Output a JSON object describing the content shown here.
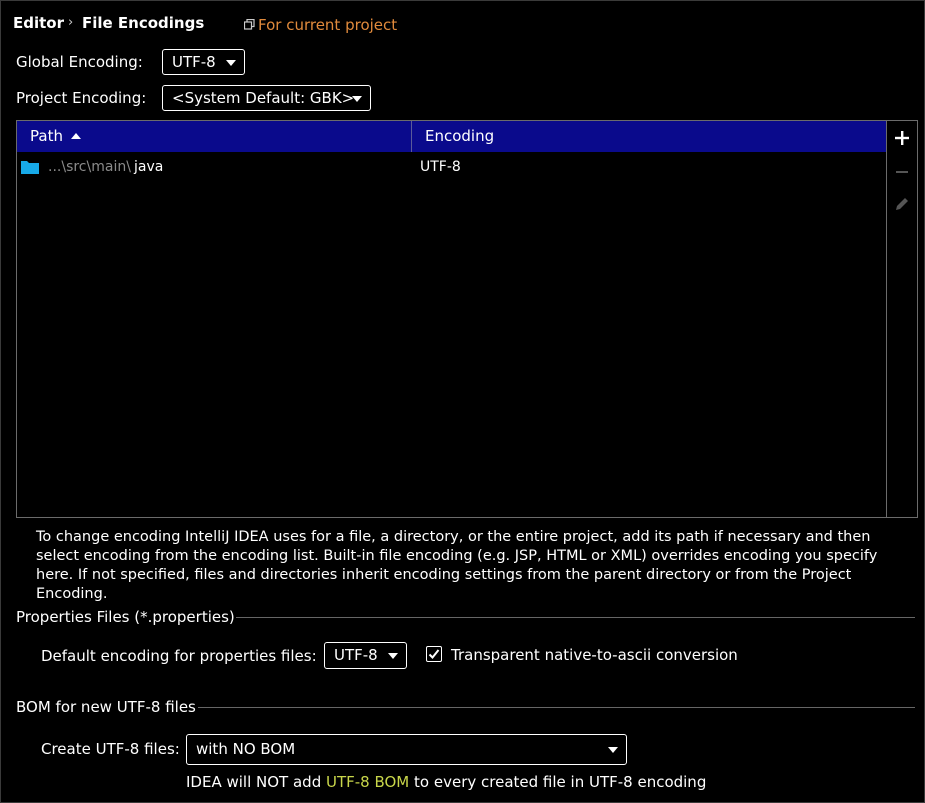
{
  "breadcrumb": {
    "parent": "Editor",
    "separator": "›",
    "current": "File Encodings"
  },
  "scope_link": {
    "icon": "copy-icon",
    "label": "For current project"
  },
  "global_encoding": {
    "label": "Global Encoding:",
    "value": "UTF-8"
  },
  "project_encoding": {
    "label": "Project Encoding:",
    "value": "<System Default: GBK>"
  },
  "table": {
    "columns": [
      "Path",
      "Encoding"
    ],
    "sort": {
      "column": "Path",
      "direction": "ascending"
    },
    "rows": [
      {
        "icon": "folder-icon",
        "path_prefix": "...\\src\\main\\",
        "path_name": "java",
        "encoding": "UTF-8"
      }
    ]
  },
  "toolbar": {
    "add_icon": "plus-icon",
    "remove_icon": "minus-icon",
    "edit_icon": "pencil-icon"
  },
  "help_text": "To change encoding IntelliJ IDEA uses for a file, a directory, or the entire project, add its path if necessary and then select encoding from the encoding list. Built-in file encoding (e.g. JSP, HTML or XML) overrides encoding you specify here. If not specified, files and directories inherit encoding settings from the parent directory or from the Project Encoding.",
  "properties_section": {
    "title": "Properties Files (*.properties)",
    "default_label": "Default encoding for properties files:",
    "default_value": "UTF-8",
    "native_to_ascii": {
      "label": "Transparent native-to-ascii conversion",
      "checked": true
    }
  },
  "bom_section": {
    "title": "BOM for new UTF-8 files",
    "create_label": "Create UTF-8 files:",
    "create_value": "with NO BOM",
    "note_before": "IDEA will NOT add ",
    "note_highlight": "UTF-8 BOM",
    "note_after": " to every created file in UTF-8 encoding"
  },
  "colors": {
    "background": "#000000",
    "table_header": "#0a0a8c",
    "link": "#e08a3c",
    "folder": "#17a9e8",
    "highlight": "#c8d64a",
    "dim_text": "#8a8a8a"
  }
}
